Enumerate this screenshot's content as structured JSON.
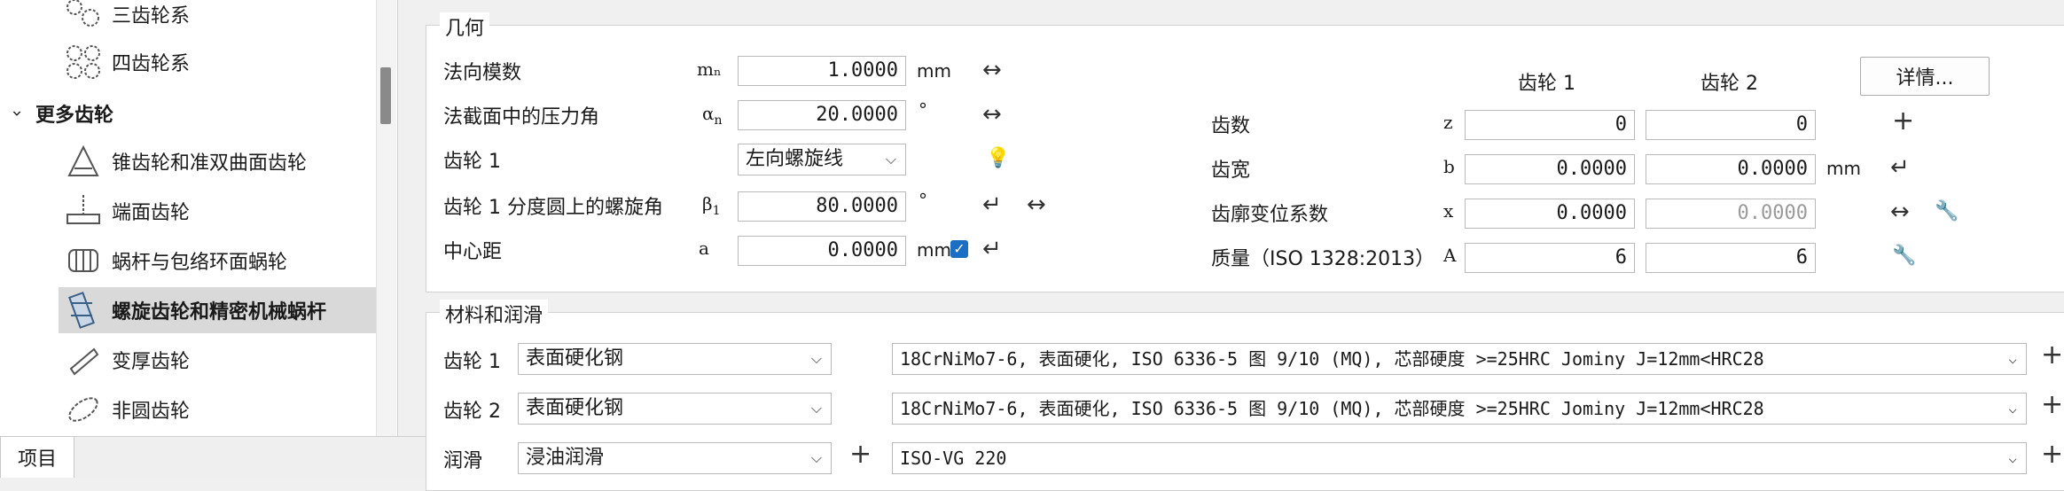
{
  "sidebar": {
    "items": [
      {
        "label": "三齿轮系",
        "icon": "gear-train-3-icon"
      },
      {
        "label": "四齿轮系",
        "icon": "gear-train-4-icon"
      },
      {
        "label": "锥齿轮和准双曲面齿轮",
        "icon": "bevel-gear-icon"
      },
      {
        "label": "端面齿轮",
        "icon": "face-gear-icon"
      },
      {
        "label": "蜗杆与包络环面蜗轮",
        "icon": "worm-gear-icon"
      },
      {
        "label": "螺旋齿轮和精密机械蜗杆",
        "icon": "crossed-helical-gear-icon"
      },
      {
        "label": "变厚齿轮",
        "icon": "beveloid-gear-icon"
      },
      {
        "label": "非圆齿轮",
        "icon": "non-circular-gear-icon"
      }
    ],
    "group_label": "更多齿轮",
    "group_toggle": "›"
  },
  "bottom_tab": "项目",
  "geometry": {
    "title": "几何",
    "normal_module": {
      "label": "法向模数",
      "symbol": "mₙ",
      "value": "1.0000",
      "unit": "mm"
    },
    "pressure_angle": {
      "label": "法截面中的压力角",
      "symbol": "α",
      "sub": "n",
      "value": "20.0000",
      "unit": "°"
    },
    "gear1_hand": {
      "label": "齿轮 1",
      "value": "左向螺旋线"
    },
    "helix_angle": {
      "label": "齿轮 1 分度圆上的螺旋角",
      "symbol": "β",
      "sub": "1",
      "value": "80.0000",
      "unit": "°"
    },
    "center_distance": {
      "label": "中心距",
      "symbol": "a",
      "value": "0.0000",
      "unit": "mm"
    },
    "col_gear1": "齿轮 1",
    "col_gear2": "齿轮 2",
    "details_button": "详情...",
    "teeth": {
      "label": "齿数",
      "symbol": "z",
      "g1": "0",
      "g2": "0"
    },
    "width": {
      "label": "齿宽",
      "symbol": "b",
      "g1": "0.0000",
      "g2": "0.0000",
      "unit": "mm"
    },
    "profile_shift": {
      "label": "齿廓变位系数",
      "symbol": "x",
      "g1": "0.0000",
      "g2": "0.0000"
    },
    "quality": {
      "label": "质量（ISO 1328:2013）",
      "symbol": "A",
      "g1": "6",
      "g2": "6"
    }
  },
  "material": {
    "title": "材料和润滑",
    "gear1": {
      "label": "齿轮 1",
      "type": "表面硬化钢",
      "spec": "18CrNiMo7-6, 表面硬化, ISO 6336-5 图 9/10 (MQ), 芯部硬度 >=25HRC Jominy J=12mm<HRC28"
    },
    "gear2": {
      "label": "齿轮 2",
      "type": "表面硬化钢",
      "spec": "18CrNiMo7-6, 表面硬化, ISO 6336-5 图 9/10 (MQ), 芯部硬度 >=25HRC Jominy J=12mm<HRC28"
    },
    "lube": {
      "label": "润滑",
      "type": "浸油润滑",
      "spec": "ISO-VG 220"
    }
  },
  "glyphs": {
    "chevron": "⌵",
    "plus": "+",
    "swap": "↔",
    "return": "↵",
    "bulb": "💡",
    "wrench": "🔧",
    "check": "✓"
  }
}
